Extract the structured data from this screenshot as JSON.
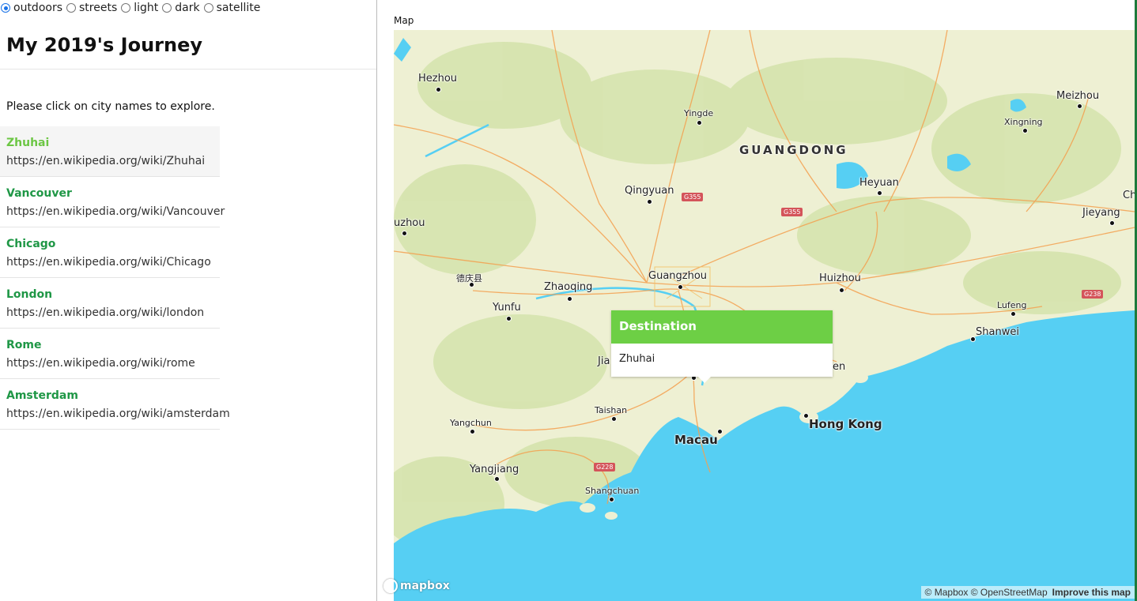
{
  "style_options": [
    {
      "label": "outdoors",
      "selected": true
    },
    {
      "label": "streets",
      "selected": false
    },
    {
      "label": "light",
      "selected": false
    },
    {
      "label": "dark",
      "selected": false
    },
    {
      "label": "satellite",
      "selected": false
    }
  ],
  "sidebar": {
    "title": "My 2019's Journey",
    "hint": "Please click on city names to explore.",
    "cities": [
      {
        "name": "Zhuhai",
        "url": "https://en.wikipedia.org/wiki/Zhuhai",
        "active": true
      },
      {
        "name": "Vancouver",
        "url": "https://en.wikipedia.org/wiki/Vancouver",
        "active": false
      },
      {
        "name": "Chicago",
        "url": "https://en.wikipedia.org/wiki/Chicago",
        "active": false
      },
      {
        "name": "London",
        "url": "https://en.wikipedia.org/wiki/london",
        "active": false
      },
      {
        "name": "Rome",
        "url": "https://en.wikipedia.org/wiki/rome",
        "active": false
      },
      {
        "name": "Amsterdam",
        "url": "https://en.wikipedia.org/wiki/amsterdam",
        "active": false
      }
    ]
  },
  "map": {
    "label": "Map",
    "region_label": "GUANGDONG",
    "places": {
      "hezhou": "Hezhou",
      "yingde": "Yingde",
      "meizhou": "Meizhou",
      "xingning": "Xingning",
      "qingyuan": "Qingyuan",
      "heyuan": "Heyuan",
      "jieyang": "Jieyang",
      "uzhou": "uzhou",
      "deqing": "德庆县",
      "zhaoqing": "Zhaoqing",
      "guangzhou": "Guangzhou",
      "huizhou": "Huizhou",
      "yunfu": "Yunfu",
      "lufeng": "Lufeng",
      "shanwei": "Shanwei",
      "jia": "Jia",
      "en": "en",
      "taishan": "Taishan",
      "yangchun": "Yangchun",
      "macau": "Macau",
      "hongkong": "Hong Kong",
      "yangjiang": "Yangjiang",
      "shangchuan": "Shangchuan",
      "ch": "Ch"
    },
    "shields": {
      "g355a": "G355",
      "g355b": "G355",
      "g238": "G238",
      "g228": "G228"
    },
    "popup": {
      "heading": "Destination",
      "body": "Zhuhai"
    },
    "logo_text": "mapbox",
    "attribution": {
      "text": "© Mapbox © OpenStreetMap",
      "improve": "Improve this map"
    },
    "colors": {
      "land": "#eef0d3",
      "forest": "#cfe0a8",
      "water": "#56cff3",
      "road": "#f4a04f",
      "accent": "#6dcf45",
      "link": "#1f9746"
    }
  }
}
